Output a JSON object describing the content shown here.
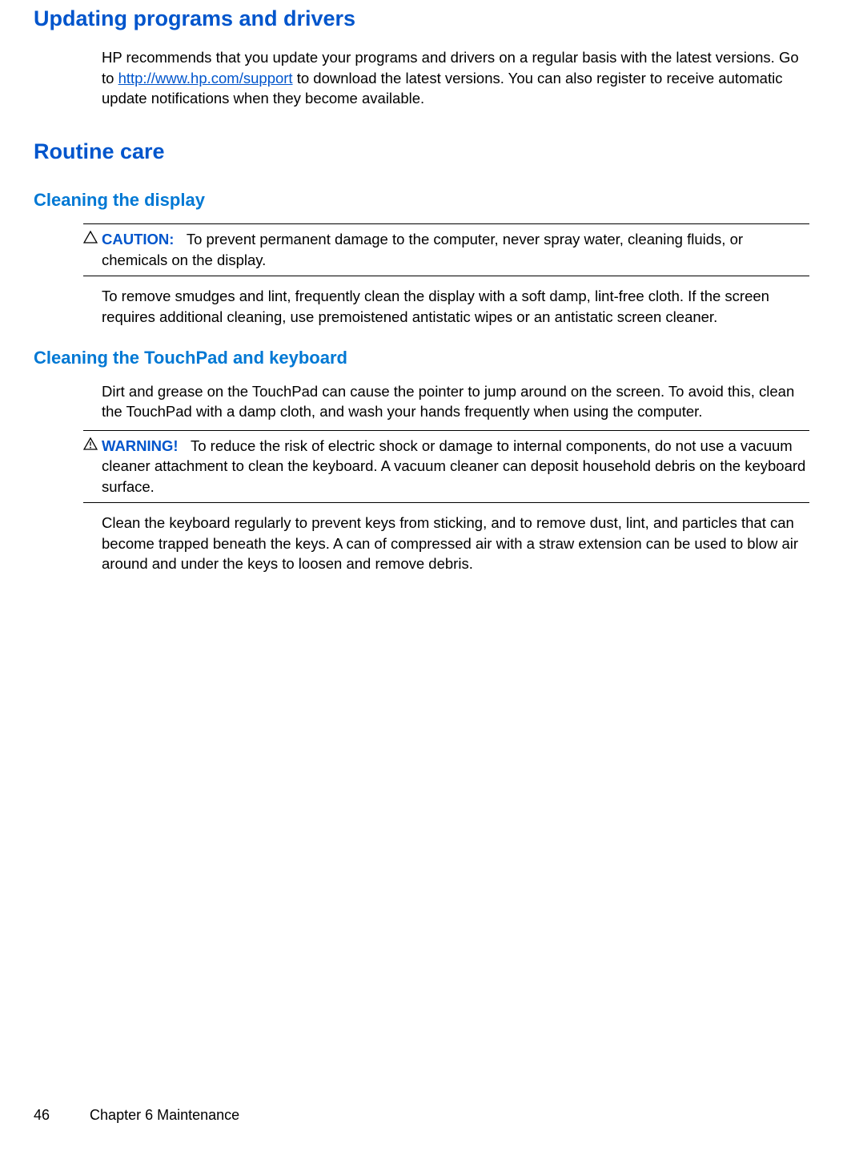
{
  "heading1": "Updating programs and drivers",
  "para1_a": "HP recommends that you update your programs and drivers on a regular basis with the latest versions. Go to ",
  "para1_link": "http://www.hp.com/support",
  "para1_b": " to download the latest versions. You can also register to receive automatic update notifications when they become available.",
  "heading2": "Routine care",
  "subheading1": "Cleaning the display",
  "caution_label": "CAUTION:",
  "caution_text": "To prevent permanent damage to the computer, never spray water, cleaning fluids, or chemicals on the display.",
  "para2": "To remove smudges and lint, frequently clean the display with a soft damp, lint-free cloth. If the screen requires additional cleaning, use premoistened antistatic wipes or an antistatic screen cleaner.",
  "subheading2": "Cleaning the TouchPad and keyboard",
  "para3": "Dirt and grease on the TouchPad can cause the pointer to jump around on the screen. To avoid this, clean the TouchPad with a damp cloth, and wash your hands frequently when using the computer.",
  "warning_label": "WARNING!",
  "warning_text": "To reduce the risk of electric shock or damage to internal components, do not use a vacuum cleaner attachment to clean the keyboard. A vacuum cleaner can deposit household debris on the keyboard surface.",
  "para4": "Clean the keyboard regularly to prevent keys from sticking, and to remove dust, lint, and particles that can become trapped beneath the keys. A can of compressed air with a straw extension can be used to blow air around and under the keys to loosen and remove debris.",
  "footer_page": "46",
  "footer_chapter": "Chapter 6   Maintenance"
}
